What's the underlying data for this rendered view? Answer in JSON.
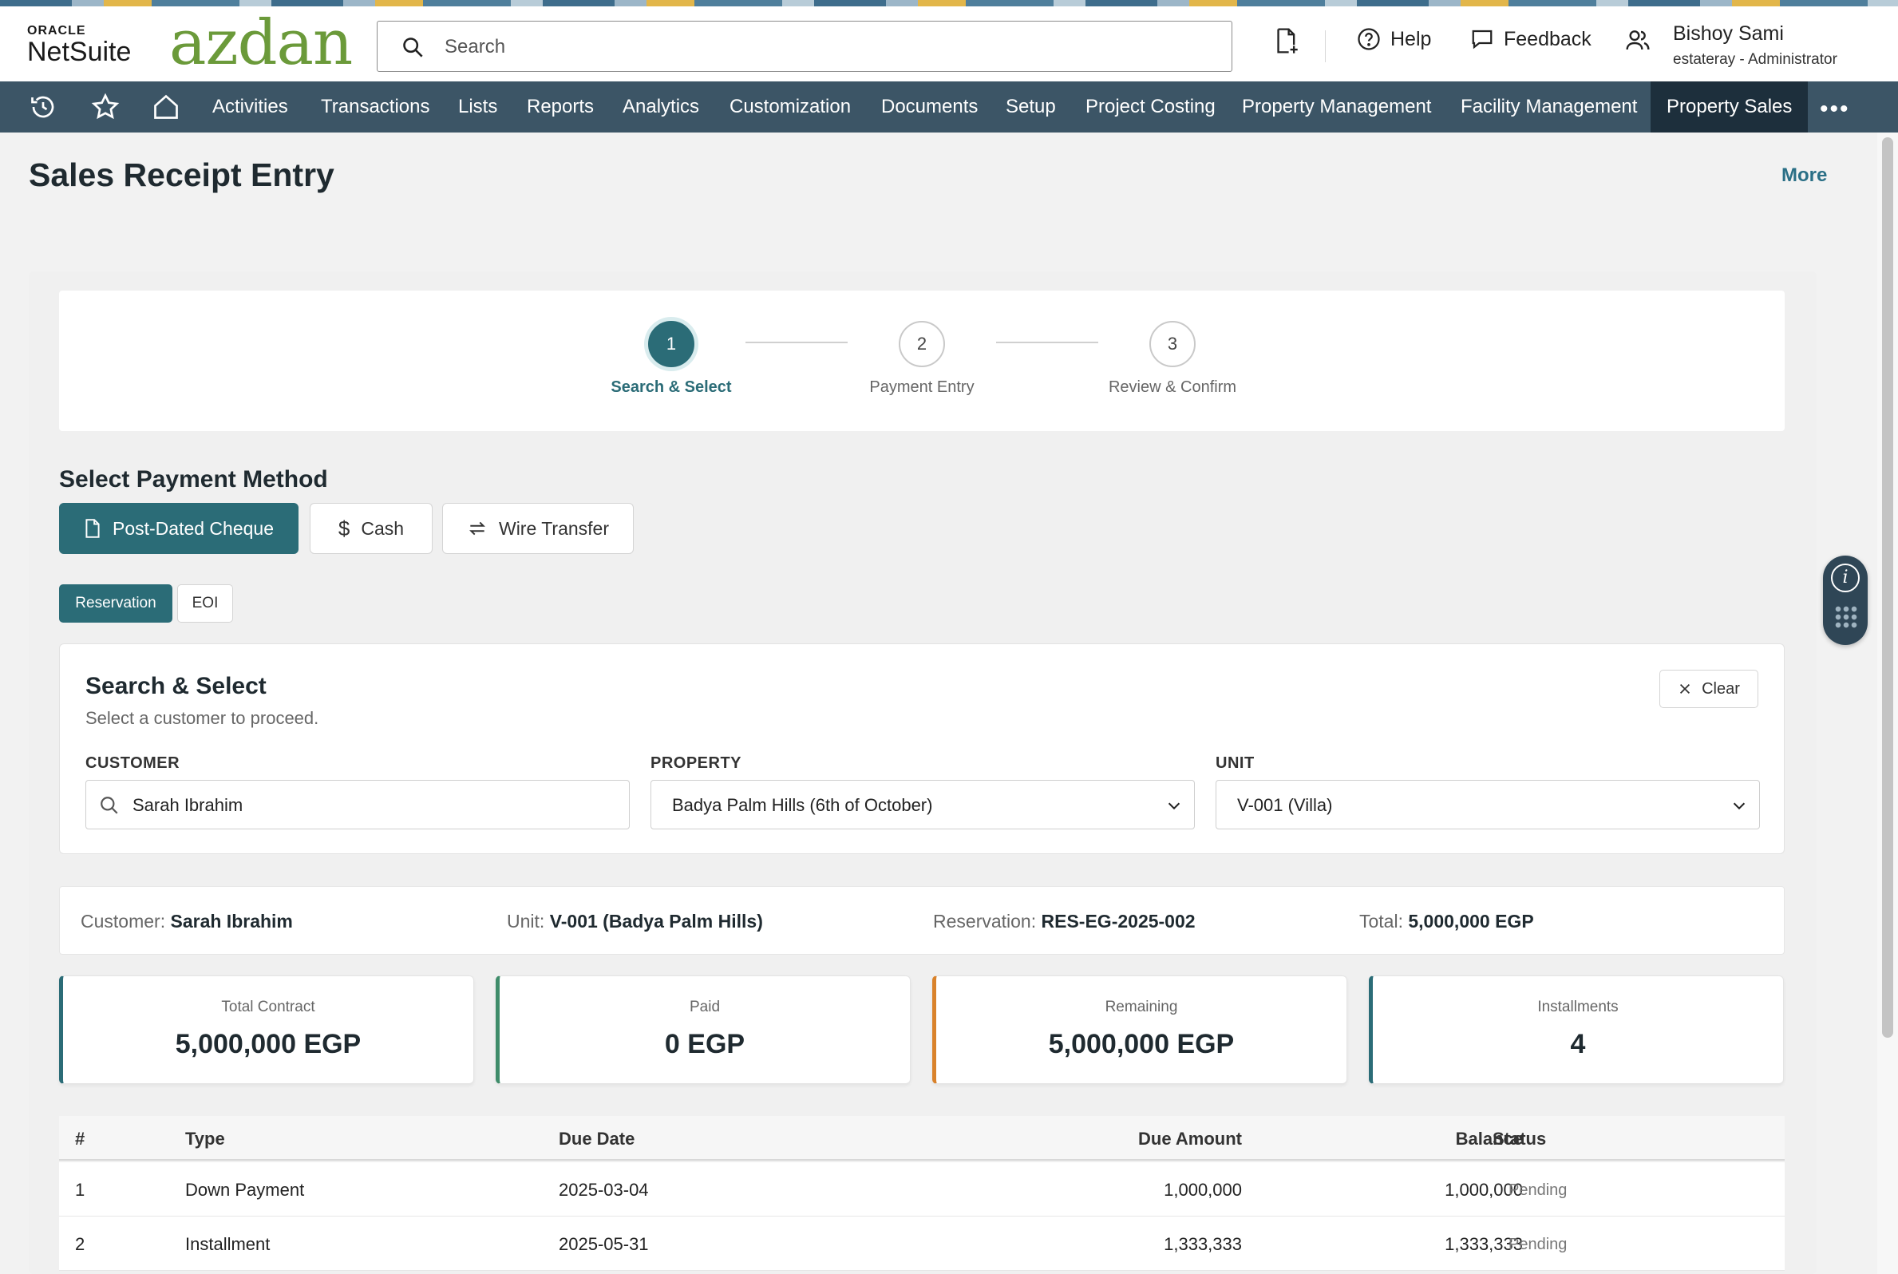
{
  "header": {
    "oracle_label": "ORACLE",
    "netsuite_label": "NetSuite",
    "brand": "azdan",
    "search_placeholder": "Search",
    "help_label": "Help",
    "feedback_label": "Feedback",
    "user_name": "Bishoy Sami",
    "user_role": "estateray - Administrator"
  },
  "nav": {
    "items": [
      "Activities",
      "Transactions",
      "Lists",
      "Reports",
      "Analytics",
      "Customization",
      "Documents",
      "Setup",
      "Project Costing",
      "Property Management",
      "Facility Management",
      "Property Sales"
    ],
    "active": "Property Sales",
    "more_label": "•••"
  },
  "page": {
    "title": "Sales Receipt Entry",
    "more_label": "More"
  },
  "stepper": {
    "steps": [
      {
        "number": "1",
        "label": "Search & Select"
      },
      {
        "number": "2",
        "label": "Payment Entry"
      },
      {
        "number": "3",
        "label": "Review & Confirm"
      }
    ],
    "active_step": 1
  },
  "payment_method": {
    "heading": "Select Payment Method",
    "options": [
      "Post-Dated Cheque",
      "Cash",
      "Wire Transfer"
    ],
    "selected": "Post-Dated Cheque"
  },
  "type_tabs": {
    "options": [
      "Reservation",
      "EOI"
    ],
    "selected": "Reservation"
  },
  "search_card": {
    "title": "Search & Select",
    "subtitle": "Select a customer to proceed.",
    "clear_label": "Clear",
    "customer_label": "CUSTOMER",
    "customer_value": "Sarah Ibrahim",
    "property_label": "PROPERTY",
    "property_value": "Badya Palm Hills (6th of October)",
    "unit_label": "UNIT",
    "unit_value": "V-001 (Villa)"
  },
  "summary": {
    "customer_key": "Customer:",
    "customer_val": "Sarah Ibrahim",
    "unit_key": "Unit:",
    "unit_val": "V-001 (Badya Palm Hills)",
    "reservation_key": "Reservation:",
    "reservation_val": "RES-EG-2025-002",
    "total_key": "Total:",
    "total_val": "5,000,000 EGP"
  },
  "stats": [
    {
      "label": "Total Contract",
      "value": "5,000,000 EGP",
      "accent": "#2b6c77"
    },
    {
      "label": "Paid",
      "value": "0 EGP",
      "accent": "#3f8c6a"
    },
    {
      "label": "Remaining",
      "value": "5,000,000 EGP",
      "accent": "#d9822b"
    },
    {
      "label": "Installments",
      "value": "4",
      "accent": "#2b6c77"
    }
  ],
  "table": {
    "columns": [
      "#",
      "Type",
      "Due Date",
      "Due Amount",
      "Balance",
      "Status"
    ],
    "rows": [
      {
        "n": "1",
        "type": "Down Payment",
        "due_date": "2025-03-04",
        "due_amount": "1,000,000",
        "balance": "1,000,000",
        "status": "Pending"
      },
      {
        "n": "2",
        "type": "Installment",
        "due_date": "2025-05-31",
        "due_amount": "1,333,333",
        "balance": "1,333,333",
        "status": "Pending"
      }
    ]
  },
  "colors": {
    "accent": "#2b6c77",
    "nav_bg": "#3c5566",
    "nav_active": "#1d2f3c",
    "brand_green": "#6b9a3a"
  }
}
